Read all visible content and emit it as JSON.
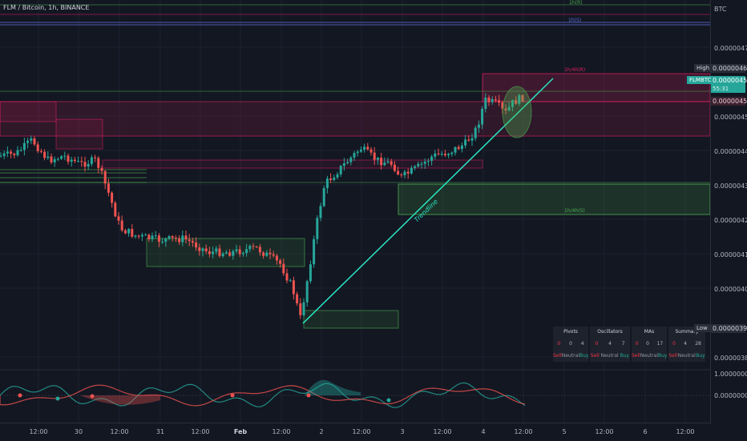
{
  "symbol_line": "FLM / Bitcoin, 1h, BINANCE",
  "currency": "BTC",
  "price_axis": {
    "ticks": [
      "0.00000470",
      "0.00000450",
      "0.00000440",
      "0.00000430",
      "0.00000420",
      "0.00000410",
      "0.00000400",
      "0.00000380"
    ],
    "osc_ticks": [
      "1.00000000",
      "0.00000000"
    ]
  },
  "flags": {
    "high_label": "High",
    "high_value": "0.00000463",
    "low_label": "Low",
    "low_value": "0.00000399",
    "symbol_tag": "FLMBTC",
    "last_price": "0.00000458",
    "countdown": "55:31",
    "level_455": "0.00000455"
  },
  "time_axis": [
    "12:00",
    "30",
    "12:00",
    "31",
    "12:00",
    "Feb",
    "12:00",
    "2",
    "12:00",
    "3",
    "12:00",
    "4",
    "12:00",
    "5",
    "12:00",
    "6",
    "12:00"
  ],
  "zone_labels": {
    "top_r": "1h(R)",
    "top_s": "1h(S)",
    "res_4h": "1h/4h(R)",
    "sup_4h": "1h/4h(S)"
  },
  "trendline_label": "Trendline",
  "ta_table": {
    "columns": [
      {
        "title": "Pivots",
        "sell": "0",
        "neutral": "0",
        "buy": "4"
      },
      {
        "title": "Oscillators",
        "sell": "0",
        "neutral": "4",
        "buy": "7"
      },
      {
        "title": "MAs",
        "sell": "0",
        "neutral": "0",
        "buy": "17"
      },
      {
        "title": "Summary",
        "sell": "0",
        "neutral": "4",
        "buy": "28"
      }
    ],
    "sell_label": "Sell",
    "neutral_label": "Neutral",
    "buy_label": "Buy"
  },
  "colors": {
    "up": "#26a69a",
    "down": "#ef5350",
    "trendline": "#29e6c3",
    "resistance": "#e91e63",
    "support": "#4caf50",
    "background": "#131722"
  }
}
